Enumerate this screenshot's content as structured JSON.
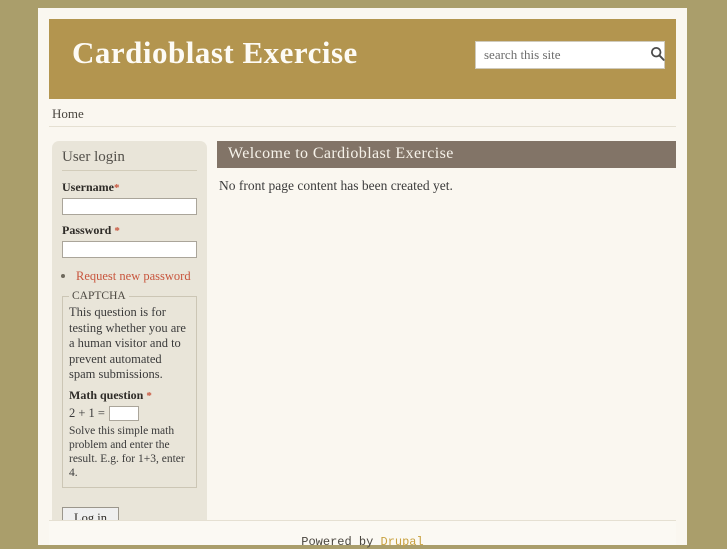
{
  "header": {
    "site_name": "Cardioblast Exercise",
    "search": {
      "placeholder": "search this site",
      "value": "",
      "icon": "search-icon",
      "submit_label": ""
    }
  },
  "menu": {
    "items": [
      {
        "label": "Home"
      }
    ]
  },
  "sidebar": {
    "block": {
      "title": "User login",
      "username": {
        "label": "Username",
        "required_marker": "*",
        "value": ""
      },
      "password": {
        "label": "Password",
        "required_marker": "*",
        "value": ""
      },
      "links": [
        {
          "label": "Request new password"
        }
      ],
      "captcha": {
        "legend": "CAPTCHA",
        "description": "This question is for testing whether you are a human visitor and to prevent automated spam submissions.",
        "math_label": "Math question",
        "math_required_marker": "*",
        "math_prompt": "2 + 1 =",
        "math_value": "",
        "help": "Solve this simple math problem and enter the result. E.g. for 1+3, enter 4."
      },
      "submit_label": "Log in"
    }
  },
  "main": {
    "title": "Welcome to Cardioblast Exercise",
    "body": "No front page content has been created yet."
  },
  "footer": {
    "powered_by": "Powered by",
    "link_label": "Drupal"
  },
  "colors": {
    "page_background": "#aa9e6b",
    "container": "#faf7f0",
    "header_banner": "#b3954f",
    "content_title_bar": "#827467",
    "sidebar_block": "#e9e5d9",
    "link": "#c8553d",
    "required": "#c8553d",
    "footer_link": "#c8a13f"
  }
}
